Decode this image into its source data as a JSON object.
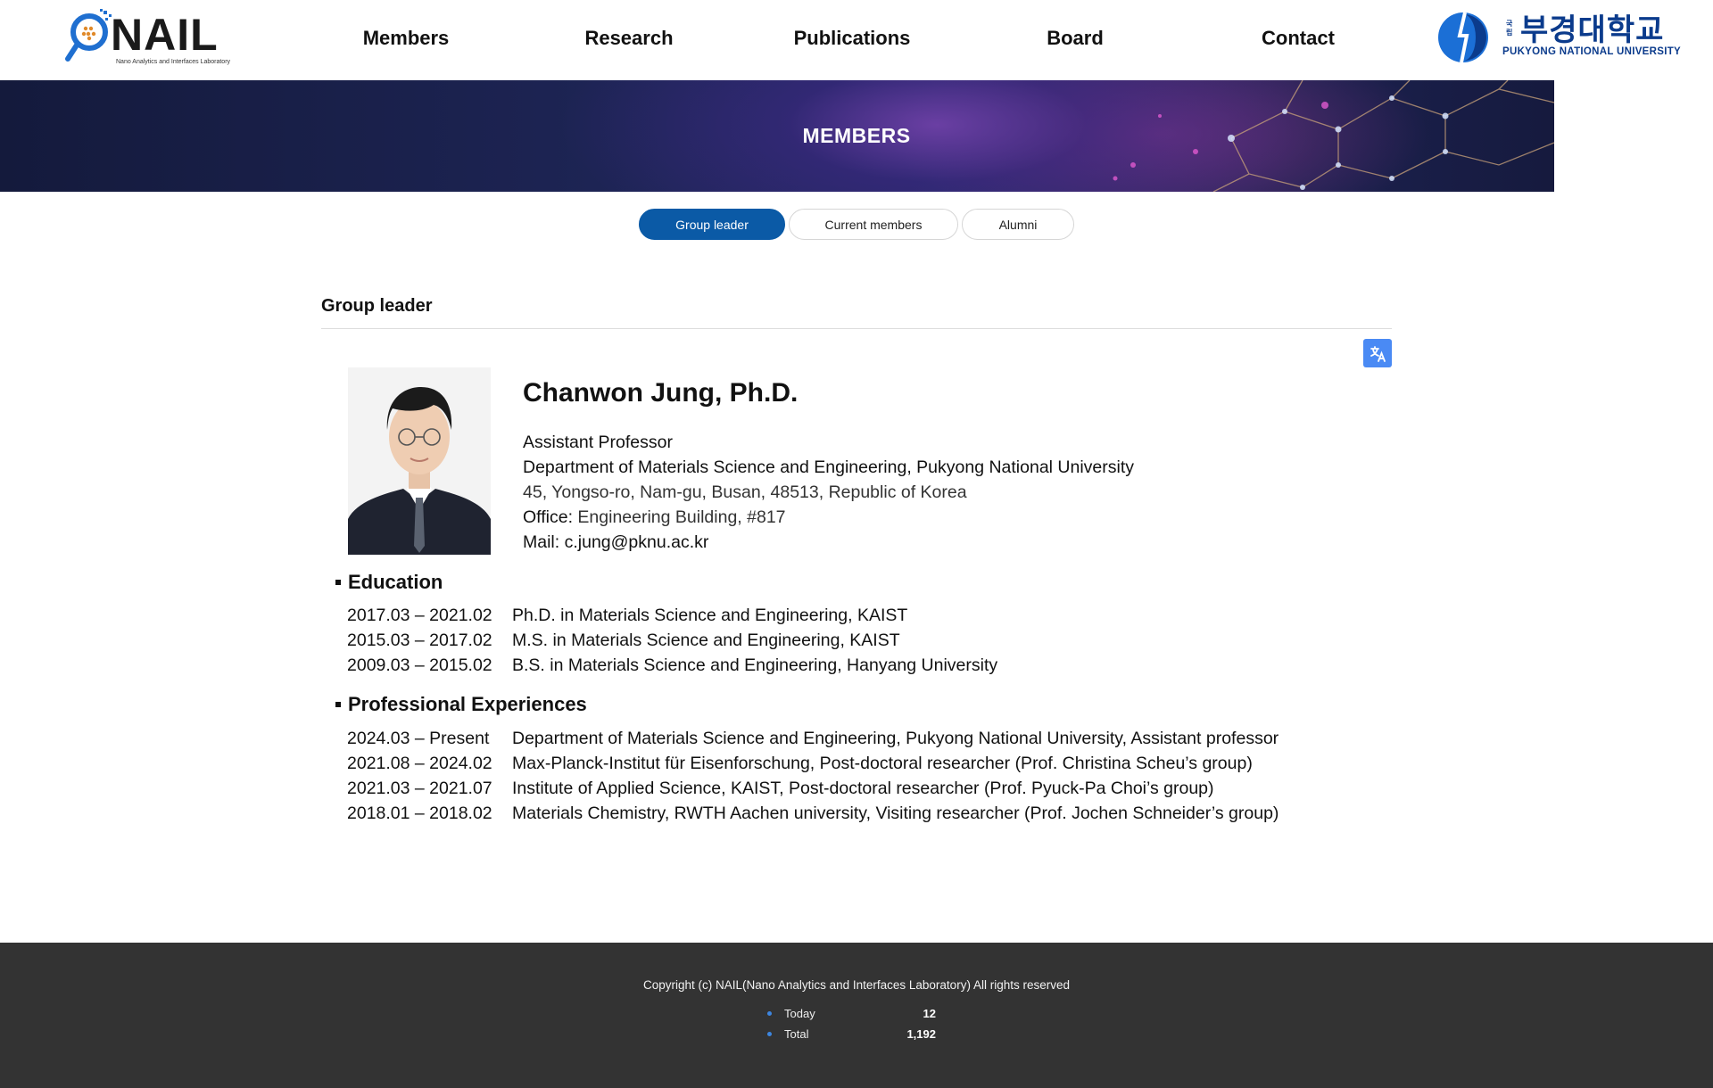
{
  "header": {
    "logo": {
      "word": "NAIL",
      "subtitle": "Nano Analytics and Interfaces Laboratory"
    },
    "nav": [
      {
        "label": "Members"
      },
      {
        "label": "Research"
      },
      {
        "label": "Publications"
      },
      {
        "label": "Board"
      },
      {
        "label": "Contact"
      }
    ],
    "university": {
      "name_ko": "부경대학교",
      "prefix_ko": "국립",
      "name_en": "PUKYONG NATIONAL UNIVERSITY"
    }
  },
  "banner": {
    "title": "MEMBERS"
  },
  "tabs": [
    {
      "label": "Group leader",
      "active": true
    },
    {
      "label": "Current members",
      "active": false
    },
    {
      "label": "Alumni",
      "active": false
    }
  ],
  "section": {
    "title": "Group leader"
  },
  "profile": {
    "name": "Chanwon Jung, Ph.D.",
    "position": "Assistant Professor",
    "department": "Department of Materials Science and Engineering, Pukyong National University",
    "address": "45, Yongso-ro, Nam-gu, Busan, 48513, Republic of Korea",
    "office_label": "Office:",
    "office": "Engineering Building, #817",
    "mail_label": "Mail:",
    "mail": "c.jung@pknu.ac.kr"
  },
  "education": {
    "heading": "Education",
    "items": [
      {
        "period": "2017.03 – 2021.02",
        "desc": "Ph.D. in Materials Science and Engineering, KAIST"
      },
      {
        "period": "2015.03 – 2017.02",
        "desc": "M.S. in Materials Science and Engineering, KAIST"
      },
      {
        "period": "2009.03 – 2015.02",
        "desc": "B.S. in Materials Science and Engineering, Hanyang University"
      }
    ]
  },
  "experience": {
    "heading": "Professional Experiences",
    "items": [
      {
        "period": "2024.03 – Present",
        "desc": "Department of Materials Science and Engineering, Pukyong National University, Assistant professor"
      },
      {
        "period": "2021.08 – 2024.02",
        "desc": "Max-Planck-Institut für Eisenforschung, Post-doctoral researcher (Prof. Christina Scheu’s group)"
      },
      {
        "period": "2021.03 – 2021.07",
        "desc": "Institute of Applied Science, KAIST, Post-doctoral researcher (Prof. Pyuck-Pa Choi’s group)"
      },
      {
        "period": "2018.01 – 2018.02",
        "desc": "Materials Chemistry, RWTH Aachen university, Visiting researcher (Prof. Jochen Schneider’s group)"
      }
    ]
  },
  "footer": {
    "copyright": "Copyright (c) NAIL(Nano Analytics and Interfaces Laboratory) All rights reserved",
    "stats": [
      {
        "label": "Today",
        "value": "12"
      },
      {
        "label": "Total",
        "value": "1,192"
      }
    ]
  },
  "colors": {
    "accent": "#0b5aa6",
    "translate_button": "#4a8af4",
    "footer_bg": "#333333",
    "university_blue": "#0b3b8c"
  },
  "icons": {
    "logo": "magnifier-logo-icon",
    "university": "university-emblem-icon",
    "translate": "translate-icon",
    "bullet": "square-bullet-icon"
  }
}
